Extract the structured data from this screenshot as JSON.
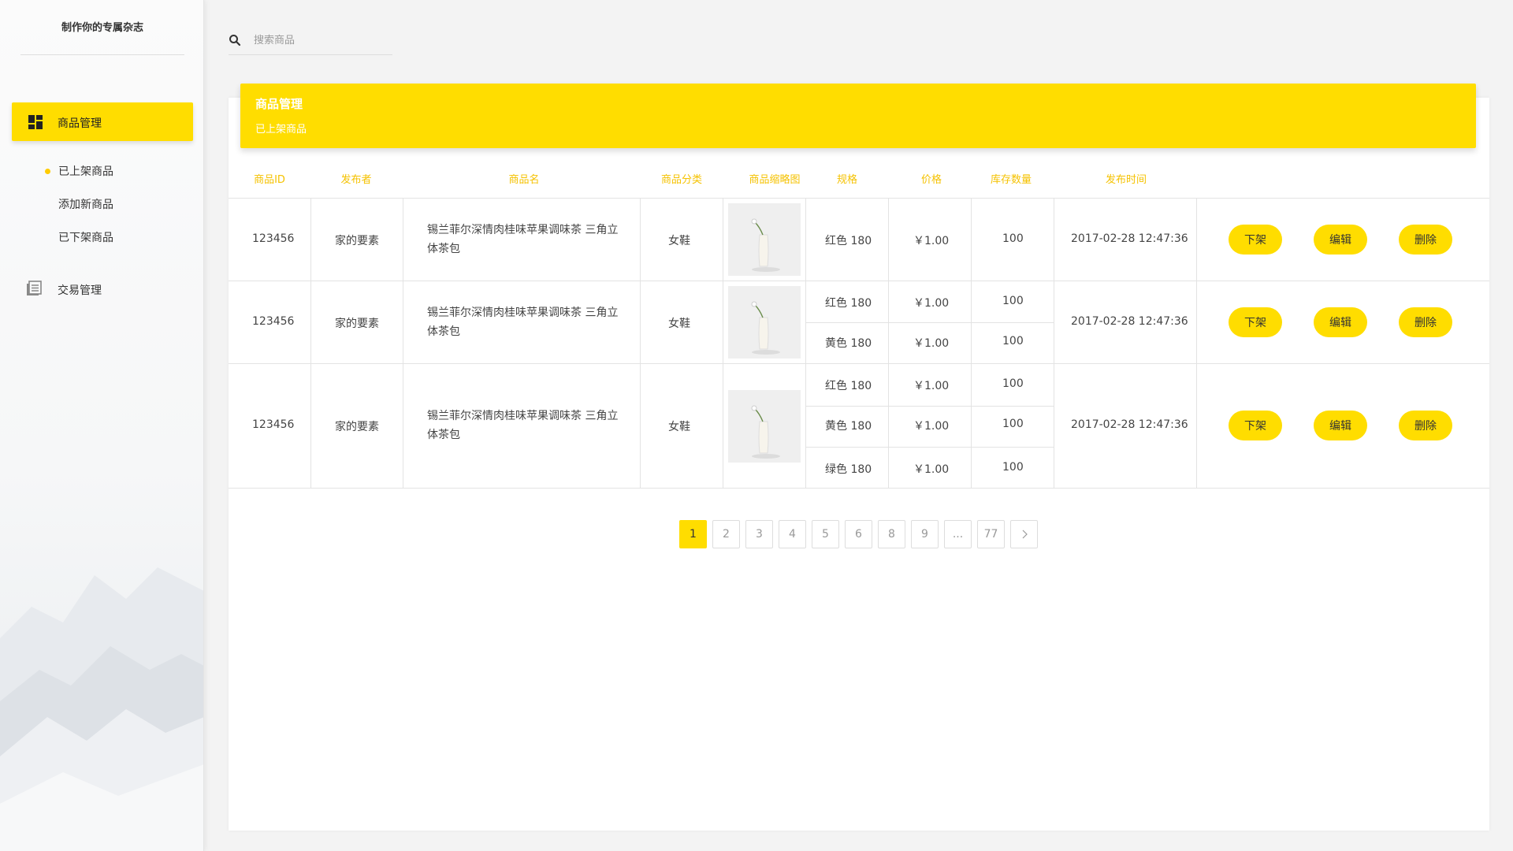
{
  "sidebar": {
    "brand": "制作你的专属杂志",
    "main_label": "商品管理",
    "sub_items": [
      {
        "label": "已上架商品"
      },
      {
        "label": "添加新商品"
      },
      {
        "label": "已下架商品"
      }
    ],
    "trade_label": "交易管理"
  },
  "search": {
    "placeholder": "搜索商品",
    "value": ""
  },
  "banner": {
    "title": "商品管理",
    "subtitle": "已上架商品"
  },
  "columns": [
    "商品ID",
    "发布者",
    "商品名",
    "商品分类",
    "商品缩略图",
    "规格",
    "价格",
    "库存数量",
    "发布时间"
  ],
  "rows": [
    {
      "id": "123456",
      "publisher": "家的要素",
      "name": "锡兰菲尔深情肉桂味苹果调味茶 三角立体茶包",
      "category": "女鞋",
      "variants": [
        {
          "spec": "红色 180",
          "price": "￥1.00",
          "stock": "100"
        }
      ],
      "time": "2017-02-28 12:47:36",
      "actions": [
        "下架",
        "编辑",
        "删除"
      ]
    },
    {
      "id": "123456",
      "publisher": "家的要素",
      "name": "锡兰菲尔深情肉桂味苹果调味茶 三角立体茶包",
      "category": "女鞋",
      "variants": [
        {
          "spec": "红色 180",
          "price": "￥1.00",
          "stock": "100"
        },
        {
          "spec": "黄色 180",
          "price": "￥1.00",
          "stock": "100"
        }
      ],
      "time": "2017-02-28 12:47:36",
      "actions": [
        "下架",
        "编辑",
        "删除"
      ]
    },
    {
      "id": "123456",
      "publisher": "家的要素",
      "name": "锡兰菲尔深情肉桂味苹果调味茶 三角立体茶包",
      "category": "女鞋",
      "variants": [
        {
          "spec": "红色 180",
          "price": "￥1.00",
          "stock": "100"
        },
        {
          "spec": "黄色 180",
          "price": "￥1.00",
          "stock": "100"
        },
        {
          "spec": "绿色 180",
          "price": "￥1.00",
          "stock": "100"
        }
      ],
      "time": "2017-02-28 12:47:36",
      "actions": [
        "下架",
        "编辑",
        "删除"
      ]
    }
  ],
  "pagination": {
    "pages": [
      "1",
      "2",
      "3",
      "4",
      "5",
      "6",
      "8",
      "9",
      "...",
      "77"
    ],
    "current": "1",
    "next_icon": "chevron-right-icon"
  },
  "colors": {
    "accent": "#ffdd00",
    "header_text": "#f5c200",
    "background": "#f3f3f3"
  }
}
